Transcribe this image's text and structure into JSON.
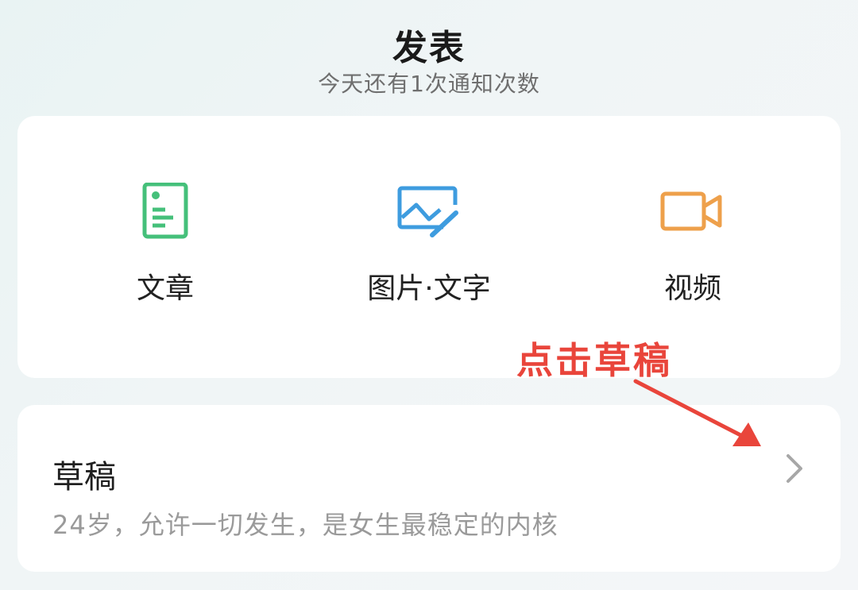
{
  "header": {
    "title": "发表",
    "subtitle": "今天还有1次通知次数"
  },
  "publish_options": [
    {
      "label": "文章",
      "icon": "document-icon",
      "color": "#45c07a"
    },
    {
      "label": "图片·文字",
      "icon": "image-icon",
      "color": "#3e9cdf"
    },
    {
      "label": "视频",
      "icon": "video-camera-icon",
      "color": "#eea04b"
    }
  ],
  "annotation": {
    "text": "点击草稿",
    "color": "#e9453b"
  },
  "drafts": {
    "title": "草稿",
    "preview": "24岁，允许一切发生，是女生最稳定的内核",
    "icon": "chevron-right-icon"
  }
}
